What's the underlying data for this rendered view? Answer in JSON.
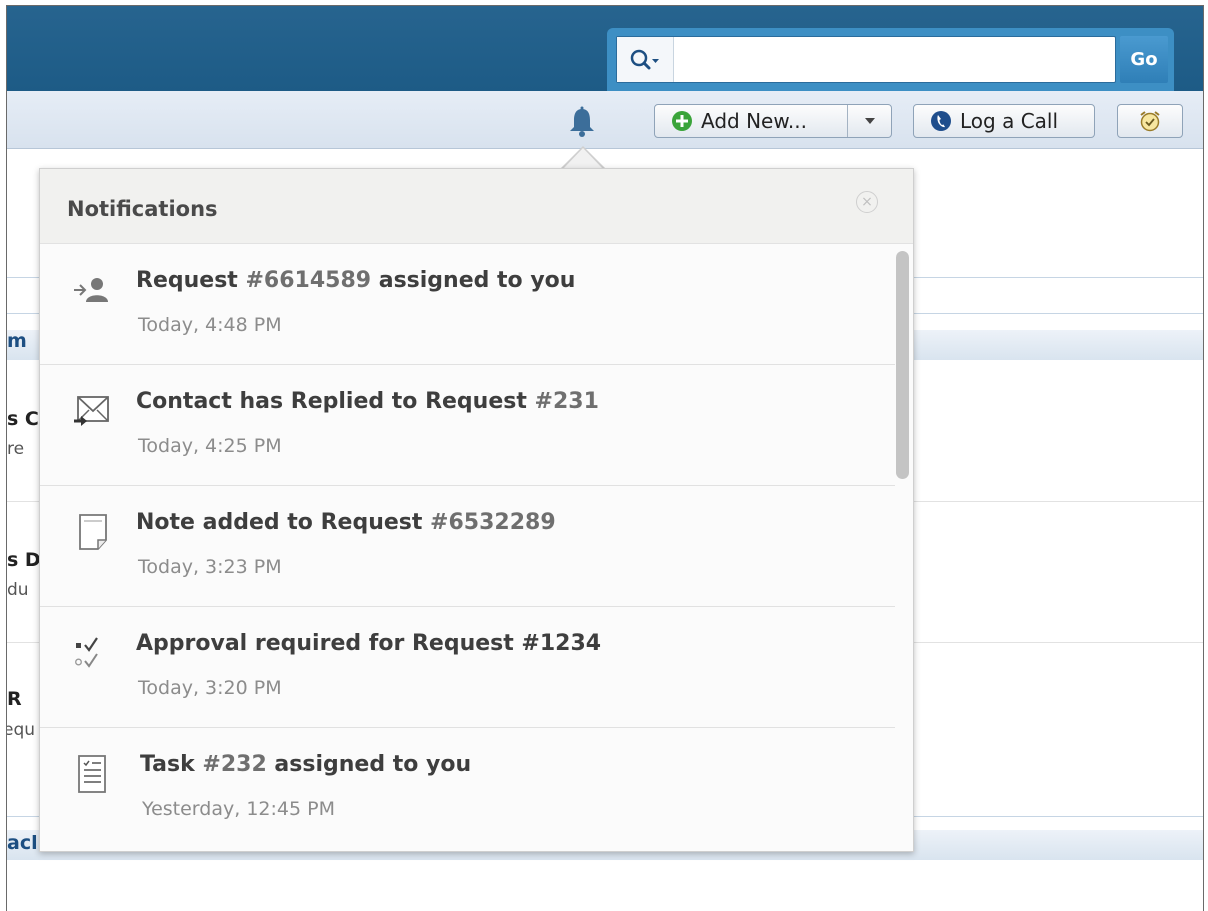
{
  "header": {
    "search": {
      "value": "",
      "placeholder": "",
      "go_label": "Go"
    },
    "icons": {
      "search": "search-icon",
      "bell": "bell-icon"
    }
  },
  "toolbar": {
    "add_new_label": "Add New...",
    "log_call_label": "Log a Call"
  },
  "background_fragments": {
    "row1_title": "m",
    "row2_title": "s C",
    "row2_sub": "re",
    "row3_title": "s D",
    "row3_sub": "du",
    "row4_title": "R",
    "row4_sub": "equ",
    "row5_title": "acl"
  },
  "notifications": {
    "title": "Notifications",
    "close_label": "×",
    "items": [
      {
        "icon": "assign-user-icon",
        "text_before": "Request ",
        "number": "#6614589",
        "text_after": " assigned to you",
        "time": "Today, 4:48 PM"
      },
      {
        "icon": "mail-reply-icon",
        "text_before": "Contact has Replied to Request ",
        "number": "#231",
        "text_after": "",
        "time": "Today, 4:25 PM"
      },
      {
        "icon": "note-icon",
        "text_before": "Note added to Request ",
        "number": "#6532289",
        "text_after": "",
        "time": "Today, 3:23 PM"
      },
      {
        "icon": "approval-checklist-icon",
        "text_before": "Approval required for Request #1234",
        "number": "",
        "text_after": "",
        "time": "Today, 3:20 PM"
      },
      {
        "icon": "task-list-icon",
        "text_before": "Task ",
        "number": "#232",
        "text_after": " assigned to you",
        "time": "Yesterday, 12:45 PM"
      }
    ]
  },
  "colors": {
    "header_blue": "#1d5b86",
    "search_tab_blue": "#3d8fc4",
    "toolbar_bg": "#dfe7f1",
    "add_icon_green": "#3aa43a",
    "call_icon_blue": "#1f4e8c",
    "bell_blue": "#3c6e9a"
  }
}
